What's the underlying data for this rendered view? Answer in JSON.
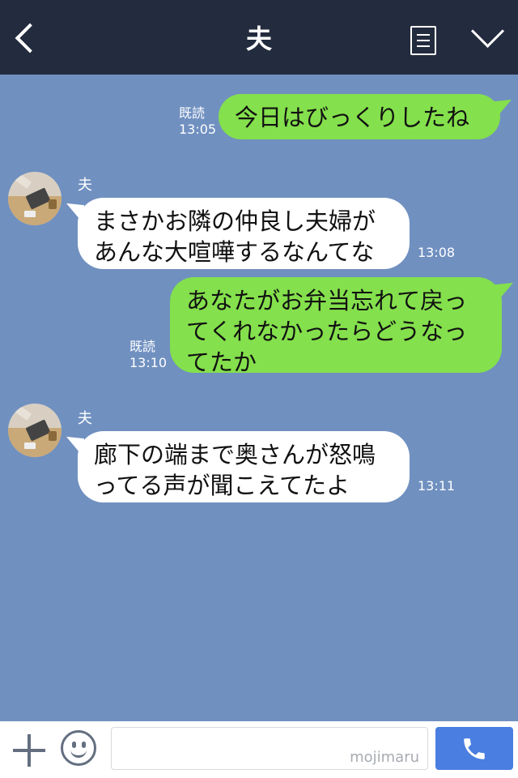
{
  "header": {
    "title": "夫"
  },
  "icons": [
    "back-icon",
    "notes-icon",
    "chevron-down-icon",
    "plus-icon",
    "emoji-icon",
    "phone-icon"
  ],
  "colors": {
    "header_bg": "#232b3e",
    "chat_bg": "#7090c0",
    "my_bubble": "#84e04c",
    "their_bubble": "#ffffff",
    "call_button": "#4a7ee0"
  },
  "messages": [
    {
      "side": "me",
      "read": "既読",
      "time": "13:05",
      "text": "今日はびっくりしたね"
    },
    {
      "side": "them",
      "name": "夫",
      "time": "13:08",
      "lines": [
        "まさかお隣の仲良し夫婦が",
        "あんな大喧嘩するなんてな"
      ]
    },
    {
      "side": "me",
      "read": "既読",
      "time": "13:10",
      "lines": [
        "あなたがお弁当忘れて戻っ",
        "てくれなかったらどうなっ",
        "てたか"
      ]
    },
    {
      "side": "them",
      "name": "夫",
      "time": "13:11",
      "lines": [
        "廊下の端まで奥さんが怒鳴",
        "ってる声が聞こえてたよ"
      ]
    }
  ],
  "footer": {
    "watermark": "mojimaru"
  }
}
